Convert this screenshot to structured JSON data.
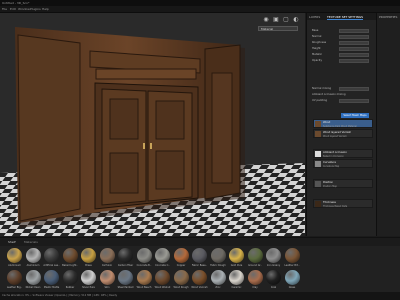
{
  "window": {
    "title": "Untitled - 3D_Scn*"
  },
  "menu": [
    "File",
    "Edit",
    "Window",
    "Plugins",
    "Help"
  ],
  "viewport": {
    "camera_select": "Material"
  },
  "panel": {
    "tabs": [
      "LAYERS",
      "TEXTURE SET SETTINGS"
    ],
    "label_1": "Base",
    "label_2": "Normal",
    "label_3": "Roughness",
    "label_4": "Height",
    "label_5": "Metallic",
    "label_6": "Opacity",
    "normal_mixing": "Normal mixing",
    "normal_mixing_value": "Combine",
    "ambient_occ": "Ambient occlusion mixing",
    "uv_padding": "UV padding",
    "uv_padding_value": "3D Space Neighbor",
    "button": "Select Mesh Maps",
    "layers": [
      {
        "name": "Wood",
        "sub": "Substance Dark Wood Material"
      },
      {
        "name": "Wood layered Varnish",
        "sub": "Wood layered Varnish"
      },
      {
        "name": "Ambient occlusion",
        "sub": "Baked in Occlusion"
      },
      {
        "name": "Curvature",
        "sub": "Curvature Map"
      },
      {
        "name": "Position",
        "sub": "Position Map"
      },
      {
        "name": "Thickness",
        "sub": "Thickness Baked Data"
      }
    ]
  },
  "panel2": {
    "tab": "PROPERTIES"
  },
  "shelf": {
    "tabs": [
      "Shelf",
      "Materials"
    ],
    "materials": [
      {
        "label": "Aluminium",
        "color": "#c9a24a"
      },
      {
        "label": "Aluminium",
        "color": "#b5b5b5"
      },
      {
        "label": "Artificial Lea..",
        "color": "#3b3b3b"
      },
      {
        "label": "Baked Light..",
        "color": "#6d4b2e"
      },
      {
        "label": "Brass",
        "color": "#c7a042"
      },
      {
        "label": "Calf skin",
        "color": "#8a6e58"
      },
      {
        "label": "Carbon Fiber",
        "color": "#2a2a2a"
      },
      {
        "label": "Concrete B..",
        "color": "#8b8b86"
      },
      {
        "label": "Concrete C..",
        "color": "#9a9a94"
      },
      {
        "label": "Copper",
        "color": "#b4693a"
      },
      {
        "label": "Fabric Base..",
        "color": "#5a5a60"
      },
      {
        "label": "Fabric Rough",
        "color": "#6e6a63"
      },
      {
        "label": "Gold Pure",
        "color": "#d6b24a"
      },
      {
        "label": "Ground Gr..",
        "color": "#5b6b3e"
      },
      {
        "label": "Iron Grainy",
        "color": "#8e8e8e"
      },
      {
        "label": "Leather Brt..",
        "color": "#7a5535"
      },
      {
        "label": "Leather Big..",
        "color": "#5e3f2a"
      },
      {
        "label": "Nickel Clean",
        "color": "#9ea3a6"
      },
      {
        "label": "Plastic Matte",
        "color": "#4a5e78"
      },
      {
        "label": "Rubber",
        "color": "#2d2d2d"
      },
      {
        "label": "Silver Pure",
        "color": "#d0d0d0"
      },
      {
        "label": "Skin",
        "color": "#c08c6e"
      },
      {
        "label": "Steel Painted",
        "color": "#6a7684"
      },
      {
        "label": "Wood Beech",
        "color": "#a97a4e"
      },
      {
        "label": "Wood Walnut",
        "color": "#6e4a2d"
      },
      {
        "label": "Wood Rough",
        "color": "#8a6a49"
      },
      {
        "label": "Wood Varnish",
        "color": "#7b4f2a"
      },
      {
        "label": "Zinc",
        "color": "#aab0b3"
      },
      {
        "label": "Ceramic",
        "color": "#d9d4cc"
      },
      {
        "label": "Clay",
        "color": "#a86c4c"
      },
      {
        "label": "Coal",
        "color": "#1f1f1f"
      },
      {
        "label": "Glass",
        "color": "#7fa6b8"
      }
    ]
  },
  "status": "Cache allocation: 8% • Software Viewer (OpenGL) | Memory: 512 MB | GPU: 48% | Ready"
}
